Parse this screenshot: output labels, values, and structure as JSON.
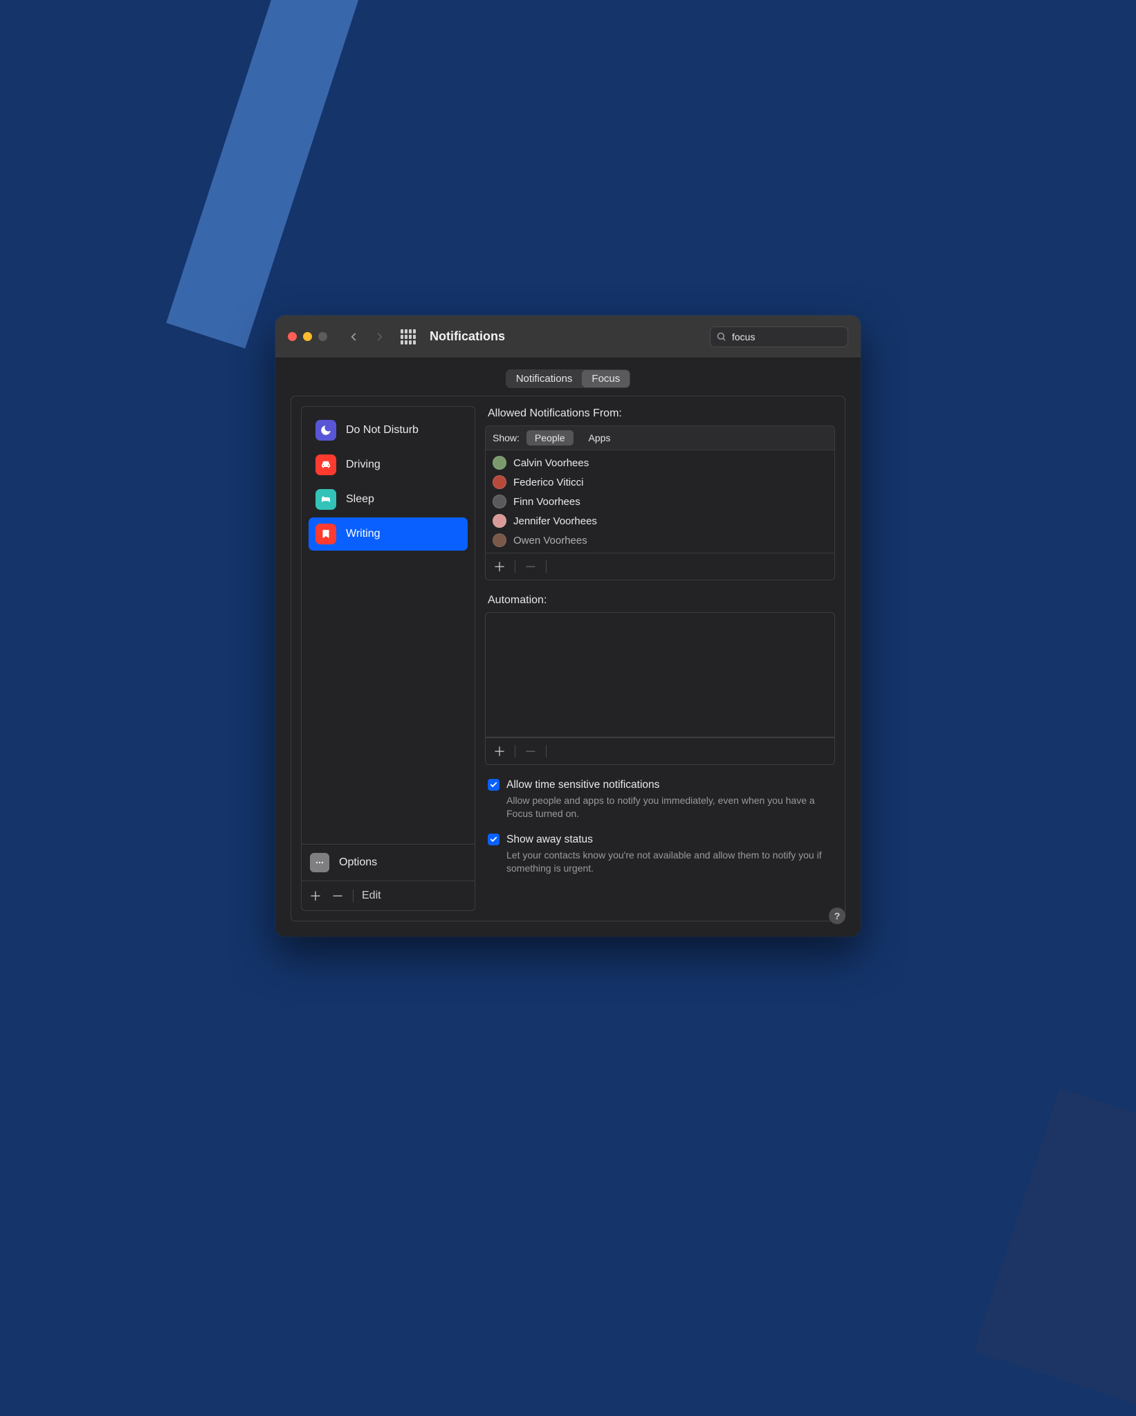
{
  "window": {
    "title": "Notifications"
  },
  "search": {
    "value": "focus",
    "placeholder": "Search"
  },
  "tabs": {
    "items": [
      "Notifications",
      "Focus"
    ],
    "active": 1
  },
  "sidebar": {
    "items": [
      {
        "label": "Do Not Disturb",
        "icon": "moon",
        "color": "#5856d6"
      },
      {
        "label": "Driving",
        "icon": "car",
        "color": "#ff3b30"
      },
      {
        "label": "Sleep",
        "icon": "bed",
        "color": "#33c3b8"
      },
      {
        "label": "Writing",
        "icon": "bookmark",
        "color": "#ff3b30",
        "selected": true
      }
    ],
    "options_label": "Options",
    "edit_label": "Edit"
  },
  "allowed": {
    "label": "Allowed Notifications From:",
    "show_label": "Show:",
    "filter": {
      "items": [
        "People",
        "Apps"
      ],
      "active": 0
    },
    "people": [
      {
        "name": "Calvin Voorhees",
        "avatar": "#7a9a6c"
      },
      {
        "name": "Federico Viticci",
        "avatar": "#b84a3a"
      },
      {
        "name": "Finn Voorhees",
        "avatar": "#5a5a5c"
      },
      {
        "name": "Jennifer Voorhees",
        "avatar": "#d99a9a"
      },
      {
        "name": "Owen Voorhees",
        "avatar": "#a0705a"
      }
    ]
  },
  "automation": {
    "label": "Automation:"
  },
  "options": {
    "time_sensitive": {
      "checked": true,
      "label": "Allow time sensitive notifications",
      "desc": "Allow people and apps to notify you immediately, even when you have a Focus turned on."
    },
    "away_status": {
      "checked": true,
      "label": "Show away status",
      "desc": "Let your contacts know you're not available and allow them to notify you if something is urgent."
    }
  }
}
